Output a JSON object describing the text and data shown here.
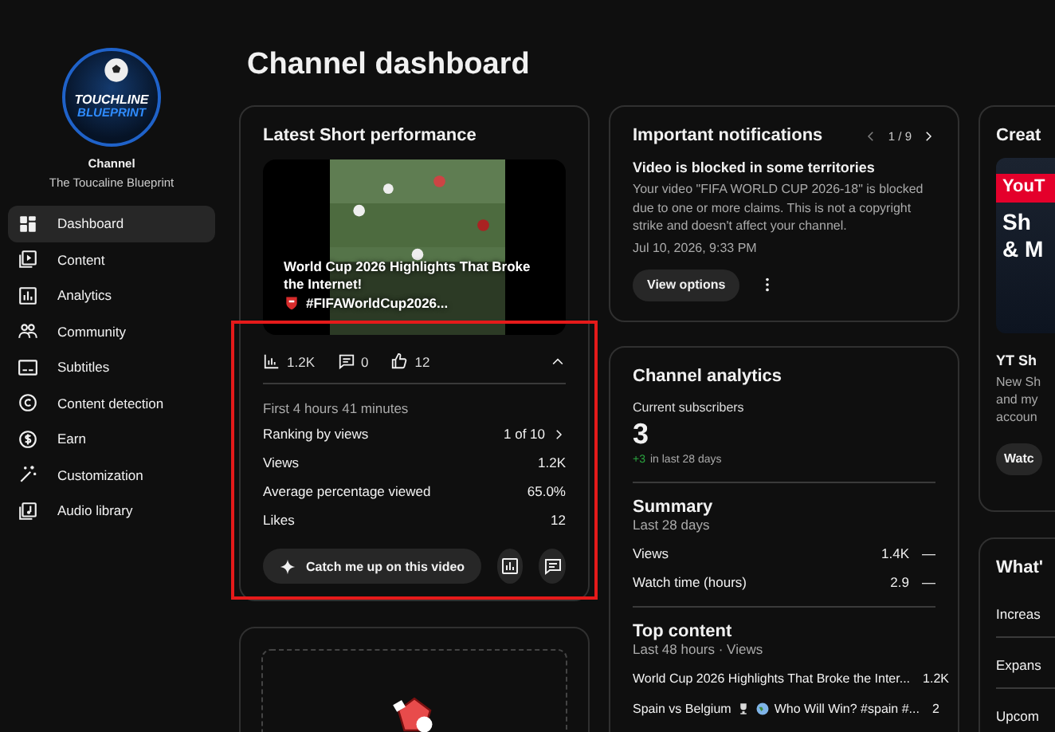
{
  "page_title": "Channel dashboard",
  "channel": {
    "logo_text": [
      "TOUCHLINE",
      "BLUEPRINT"
    ],
    "label": "Channel",
    "name": "The Toucaline Blueprint"
  },
  "sidebar": {
    "items": [
      {
        "label": "Dashboard",
        "selected": true
      },
      {
        "label": "Content",
        "selected": false
      },
      {
        "label": "Analytics",
        "selected": false
      },
      {
        "label": "Community",
        "selected": false
      },
      {
        "label": "Subtitles",
        "selected": false
      },
      {
        "label": "Content detection",
        "selected": false
      },
      {
        "label": "Earn",
        "selected": false
      },
      {
        "label": "Customization",
        "selected": false
      },
      {
        "label": "Audio library",
        "selected": false
      }
    ]
  },
  "latest_short": {
    "title": "Latest Short performance",
    "video_title": "World Cup 2026 Highlights That Broke the Internet!",
    "video_title_tail": "#FIFAWorldCup2026...",
    "highlighted": true,
    "stats": [
      {
        "value": "1.2K"
      },
      {
        "value": "0"
      },
      {
        "value": "12"
      }
    ],
    "expanded": true,
    "period": "First 4 hours 41 minutes",
    "metrics": [
      {
        "label": "Ranking by views",
        "value": "1 of 10",
        "kind": "link"
      },
      {
        "label": "Views",
        "value": "1.2K",
        "kind": "plain"
      },
      {
        "label": "Average percentage viewed",
        "value": "65.0%",
        "kind": "plain"
      },
      {
        "label": "Likes",
        "value": "12",
        "kind": "plain"
      }
    ],
    "catch_up_button": "Catch me up on this video"
  },
  "notifications": {
    "title": "Important notifications",
    "pager": "1 / 9",
    "prev_disabled": true,
    "heading": "Video is blocked in some territories",
    "body": "Your video \"FIFA WORLD CUP 2026-18\" is blocked due to one or more claims. This is not a copyright strike and doesn't affect your channel.",
    "date": "Jul 10, 2026, 9:33 PM",
    "button": "View options"
  },
  "channel_analytics": {
    "title": "Channel analytics",
    "subscribers_label": "Current subscribers",
    "subscribers": "3",
    "change": "+3",
    "change_note": "in last 28 days",
    "summary": {
      "title": "Summary",
      "period": "Last 28 days",
      "rows": [
        {
          "label": "Views",
          "value": "1.4K",
          "trend": "—"
        },
        {
          "label": "Watch time (hours)",
          "value": "2.9",
          "trend": "—"
        }
      ]
    },
    "top_content": {
      "title": "Top content",
      "period": "Last 48 hours · Views",
      "rows": [
        {
          "title": "World Cup 2026 Highlights That Broke the Inter...",
          "value": "1.2K",
          "kind": "plain"
        },
        {
          "title": "Spain vs Belgium",
          "title_tail": "Who Will Win? #spain #...",
          "value": "2",
          "kind": "emoji"
        }
      ]
    }
  },
  "creator_card": {
    "title": "Creat",
    "image_texts": [
      "YouT",
      "Sh",
      "& M"
    ],
    "item_title": "YT Sh",
    "item_lines": [
      "New Sh",
      "and my",
      "accoun"
    ],
    "button": "Watc"
  },
  "whats_new": {
    "title": "What'",
    "items": [
      "Increas",
      "Expans",
      "Upcom"
    ]
  }
}
